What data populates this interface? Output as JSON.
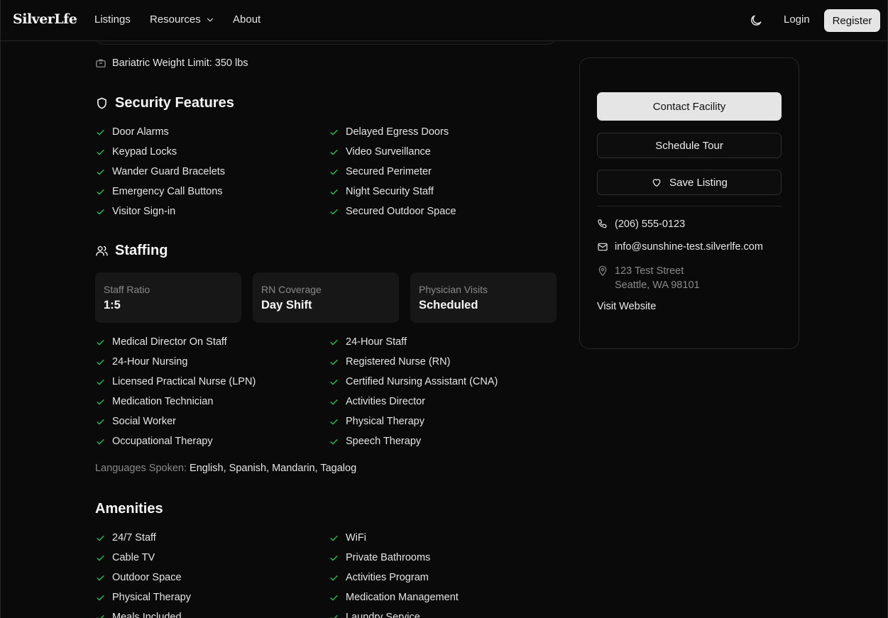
{
  "nav": {
    "logo": "SilverLfe",
    "links": [
      "Listings",
      "Resources",
      "About"
    ],
    "login": "Login",
    "register": "Register"
  },
  "capacity": {
    "bariatric": "Bariatric Weight Limit: 350 lbs"
  },
  "security": {
    "title": "Security Features",
    "items": [
      "Door Alarms",
      "Delayed Egress Doors",
      "Keypad Locks",
      "Video Surveillance",
      "Wander Guard Bracelets",
      "Secured Perimeter",
      "Emergency Call Buttons",
      "Night Security Staff",
      "Visitor Sign-in",
      "Secured Outdoor Space"
    ]
  },
  "staffing": {
    "title": "Staffing",
    "stats": [
      {
        "label": "Staff Ratio",
        "value": "1:5"
      },
      {
        "label": "RN Coverage",
        "value": "Day Shift"
      },
      {
        "label": "Physician Visits",
        "value": "Scheduled"
      }
    ],
    "items": [
      "Medical Director On Staff",
      "24-Hour Staff",
      "24-Hour Nursing",
      "Registered Nurse (RN)",
      "Licensed Practical Nurse (LPN)",
      "Certified Nursing Assistant (CNA)",
      "Medication Technician",
      "Activities Director",
      "Social Worker",
      "Physical Therapy",
      "Occupational Therapy",
      "Speech Therapy"
    ],
    "languages_label": "Languages Spoken:",
    "languages": "English, Spanish, Mandarin, Tagalog"
  },
  "amenities": {
    "title": "Amenities",
    "items": [
      "24/7 Staff",
      "WiFi",
      "Cable TV",
      "Private Bathrooms",
      "Outdoor Space",
      "Activities Program",
      "Physical Therapy",
      "Medication Management",
      "Meals Included",
      "Laundry Service"
    ]
  },
  "sidebar": {
    "contact_button": "Contact Facility",
    "tour_button": "Schedule Tour",
    "save_button": "Save Listing",
    "phone": "(206) 555-0123",
    "email": "info@sunshine-test.silverlfe.com",
    "address_line1": "123 Test Street",
    "address_line2": "Seattle, WA 98101",
    "website": "Visit Website"
  },
  "colors": {
    "check": "#22c55e",
    "background": "#0a0a0a",
    "card": "#171717"
  }
}
